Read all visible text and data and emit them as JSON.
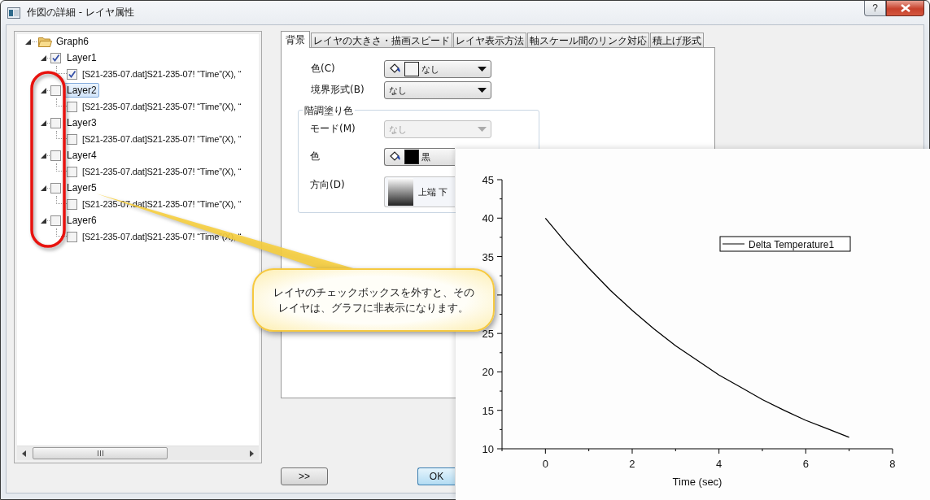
{
  "window": {
    "title": "作図の詳細 - レイヤ属性",
    "help_button": "?"
  },
  "tree": {
    "label": "Graph6",
    "expanded": true,
    "children": [
      {
        "label": "Layer1",
        "checked": true,
        "selected": false,
        "expanded": true,
        "children": [
          {
            "label": "[S21-235-07.dat]S21-235-07! “Time”(X), “",
            "checked": true
          }
        ]
      },
      {
        "label": "Layer2",
        "checked": false,
        "selected": true,
        "expanded": true,
        "children": [
          {
            "label": "[S21-235-07.dat]S21-235-07! “Time”(X), “",
            "checked": false
          }
        ]
      },
      {
        "label": "Layer3",
        "checked": false,
        "selected": false,
        "expanded": true,
        "children": [
          {
            "label": "[S21-235-07.dat]S21-235-07! “Time”(X), “",
            "checked": false
          }
        ]
      },
      {
        "label": "Layer4",
        "checked": false,
        "selected": false,
        "expanded": true,
        "children": [
          {
            "label": "[S21-235-07.dat]S21-235-07! “Time”(X), “",
            "checked": false
          }
        ]
      },
      {
        "label": "Layer5",
        "checked": false,
        "selected": false,
        "expanded": true,
        "children": [
          {
            "label": "[S21-235-07.dat]S21-235-07! “Time”(X), “",
            "checked": false
          }
        ]
      },
      {
        "label": "Layer6",
        "checked": false,
        "selected": false,
        "expanded": true,
        "children": [
          {
            "label": "[S21-235-07.dat]S21-235-07! “Time”(X), “",
            "checked": false
          }
        ]
      }
    ]
  },
  "tabs": [
    {
      "label": "背景",
      "selected": true
    },
    {
      "label": "レイヤの大きさ・描画スピード",
      "selected": false
    },
    {
      "label": "レイヤ表示方法",
      "selected": false
    },
    {
      "label": "軸スケール間のリンク対応",
      "selected": false
    },
    {
      "label": "積上げ形式",
      "selected": false
    }
  ],
  "background_form": {
    "fields": [
      {
        "kind": "color",
        "label": "色(C)",
        "value": "なし",
        "color": "#f4f4f4",
        "disabled": false
      },
      {
        "kind": "select",
        "label": "境界形式(B)",
        "value": "なし",
        "disabled": false
      }
    ],
    "gradient_group": {
      "title": "階調塗り色",
      "fields": [
        {
          "kind": "select",
          "label": "モード(M)",
          "value": "なし",
          "disabled": true
        },
        {
          "kind": "color",
          "label": "色",
          "value": "黒",
          "color": "#000000",
          "disabled": false
        },
        {
          "kind": "gradient",
          "label": "方向(D)",
          "value": "上端 下",
          "disabled": false
        }
      ]
    }
  },
  "buttons": [
    ">>",
    "OK"
  ],
  "callout": {
    "lines": [
      "レイヤのチェックボックスを外すと、その",
      "レイヤは、グラフに非表示になります。"
    ]
  },
  "graph": {
    "chart_data": {
      "type": "line",
      "xlabel": "Time (sec)",
      "x": [
        0,
        0.5,
        1,
        1.5,
        2,
        2.5,
        3,
        3.5,
        4,
        4.5,
        5,
        5.5,
        6,
        6.5,
        7
      ],
      "series": [
        {
          "name": "Delta Temperature1",
          "color": "#000000",
          "values": [
            40,
            36.6,
            33.5,
            30.6,
            28.0,
            25.6,
            23.4,
            21.5,
            19.6,
            18.0,
            16.4,
            15.0,
            13.7,
            12.6,
            11.5
          ]
        }
      ],
      "xlim": [
        -1,
        8
      ],
      "ylim": [
        10,
        45
      ],
      "xticks": [
        0,
        2,
        4,
        6,
        8
      ],
      "yticks": [
        10,
        15,
        20,
        25,
        35,
        40,
        45
      ]
    }
  }
}
